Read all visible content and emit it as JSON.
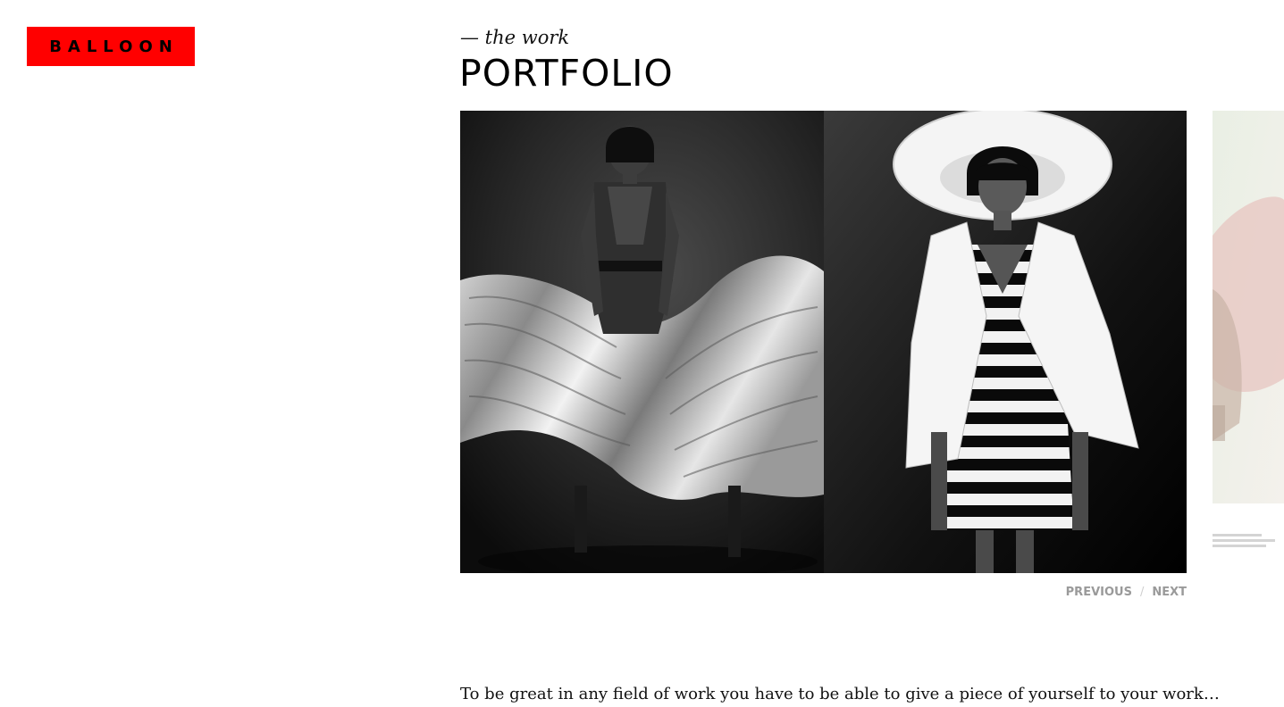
{
  "brand": {
    "logo_text": "BALLOON",
    "logo_color": "#ff0000"
  },
  "header": {
    "kicker": "— the work",
    "title": "PORTFOLIO"
  },
  "gallery": {
    "slides": [
      {
        "icon": "photo",
        "description_key": "fashion-model-flowing-skirt"
      },
      {
        "icon": "photo",
        "description_key": "fashion-model-striped-dress-hat"
      },
      {
        "icon": "photo",
        "description_key": "partial-next-slide"
      }
    ]
  },
  "pager": {
    "previous_label": "PREVIOUS",
    "separator": "/",
    "next_label": "NEXT"
  },
  "intro": {
    "text": "To be great in any field of work you have to be able to give a piece of yourself to your work… to be"
  }
}
